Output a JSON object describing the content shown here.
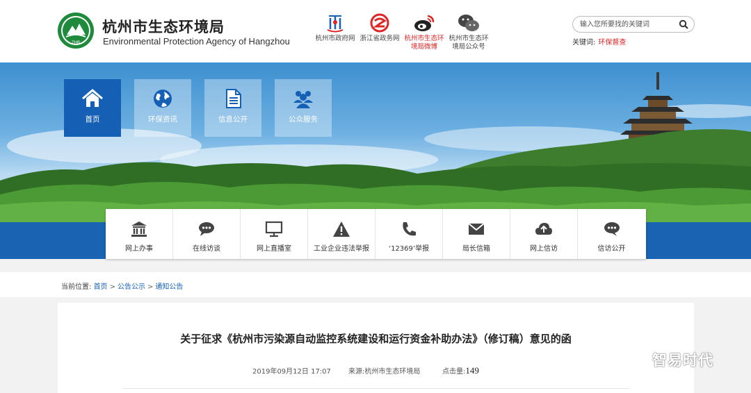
{
  "header": {
    "title_cn": "杭州市生态环境局",
    "title_en": "Environmental Protection Agency of Hangzhou",
    "logo_text": "ZHB",
    "quick_links": [
      {
        "label": "杭州市政府网",
        "icon": "hangzhou-gov-icon",
        "highlight": false
      },
      {
        "label": "浙江省政务网",
        "icon": "zhejiang-gov-icon",
        "highlight": false
      },
      {
        "label": "杭州市生态环境局微博",
        "icon": "weibo-icon",
        "highlight": true
      },
      {
        "label": "杭州市生态环境局公众号",
        "icon": "wechat-icon",
        "highlight": false
      }
    ],
    "search": {
      "placeholder": "输入您所要找的关键词"
    },
    "keywords_label": "关键词:",
    "keyword": "环保督查"
  },
  "nav": {
    "tiles": [
      {
        "label": "首页",
        "icon": "home-icon",
        "active": true
      },
      {
        "label": "环保资讯",
        "icon": "globe-icon",
        "active": false
      },
      {
        "label": "信息公开",
        "icon": "document-icon",
        "active": false
      },
      {
        "label": "公众服务",
        "icon": "people-icon",
        "active": false
      }
    ]
  },
  "services": [
    {
      "label": "网上办事",
      "icon": "institution-icon"
    },
    {
      "label": "在线访谈",
      "icon": "chat-bubble-icon"
    },
    {
      "label": "网上直播室",
      "icon": "monitor-icon"
    },
    {
      "label": "工业企业违法举报",
      "icon": "warning-icon"
    },
    {
      "label": "‘12369’举报",
      "icon": "phone-icon"
    },
    {
      "label": "局长信箱",
      "icon": "envelope-icon"
    },
    {
      "label": "网上信访",
      "icon": "cloud-upload-icon"
    },
    {
      "label": "信访公开",
      "icon": "comment-icon"
    }
  ],
  "breadcrumb": {
    "prefix": "当前位置:",
    "items": [
      "首页",
      "公告公示",
      "通知公告"
    ],
    "separator": ">"
  },
  "article": {
    "title": "关于征求《杭州市污染源自动监控系统建设和运行资金补助办法》（修订稿）意见的函",
    "date": "2019年09月12日 17:07",
    "source": "来源:杭州市生态环境局",
    "hits_label": "点击量:",
    "hits": "149"
  },
  "watermark": {
    "text": "智易时代"
  },
  "colors": {
    "primary": "#1560b5",
    "accent_red": "#e02525",
    "logo_green": "#1f8a3b"
  }
}
